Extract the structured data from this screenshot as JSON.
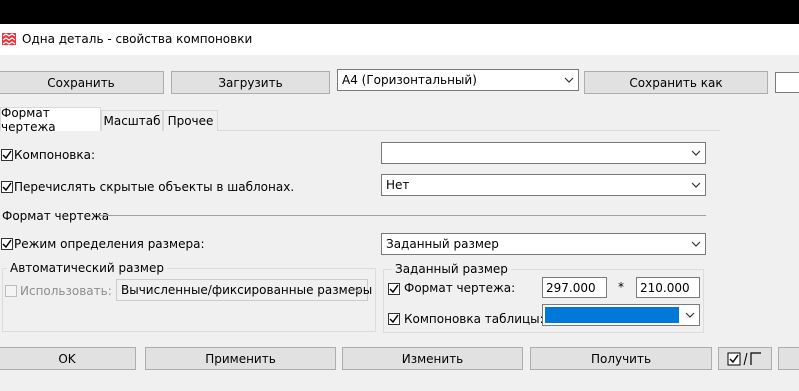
{
  "window": {
    "title": "Одна деталь - свойства компоновки"
  },
  "toolbar": {
    "save_label": "Сохранить",
    "load_label": "Загрузить",
    "preset_value": "A4 (Горизонтальный)",
    "save_as_label": "Сохранить как"
  },
  "tabs": [
    {
      "label": "Формат чертежа"
    },
    {
      "label": "Масштаб"
    },
    {
      "label": "Прочее"
    }
  ],
  "form": {
    "layout_label": "Компоновка:",
    "layout_value": "",
    "hidden_label": "Перечислять скрытые объекты в шаблонах.",
    "hidden_value": "Нет",
    "section_label": "Формат чертежа",
    "size_mode_label": "Режим определения размера:",
    "size_mode_value": "Заданный размер"
  },
  "auto_group": {
    "title": "Автоматический размер",
    "use_label": "Использовать:",
    "use_value": "Вычисленные/фиксированные размеры"
  },
  "fixed_group": {
    "title": "Заданный размер",
    "format_label": "Формат чертежа:",
    "width": "297.000",
    "times": "*",
    "height": "210.000",
    "table_label": "Компоновка таблицы:",
    "table_color": "#0078d7"
  },
  "buttons": {
    "ok": "OK",
    "apply": "Применить",
    "modify": "Изменить",
    "get": "Получить"
  },
  "colors": {
    "accent": "#0078d7"
  }
}
